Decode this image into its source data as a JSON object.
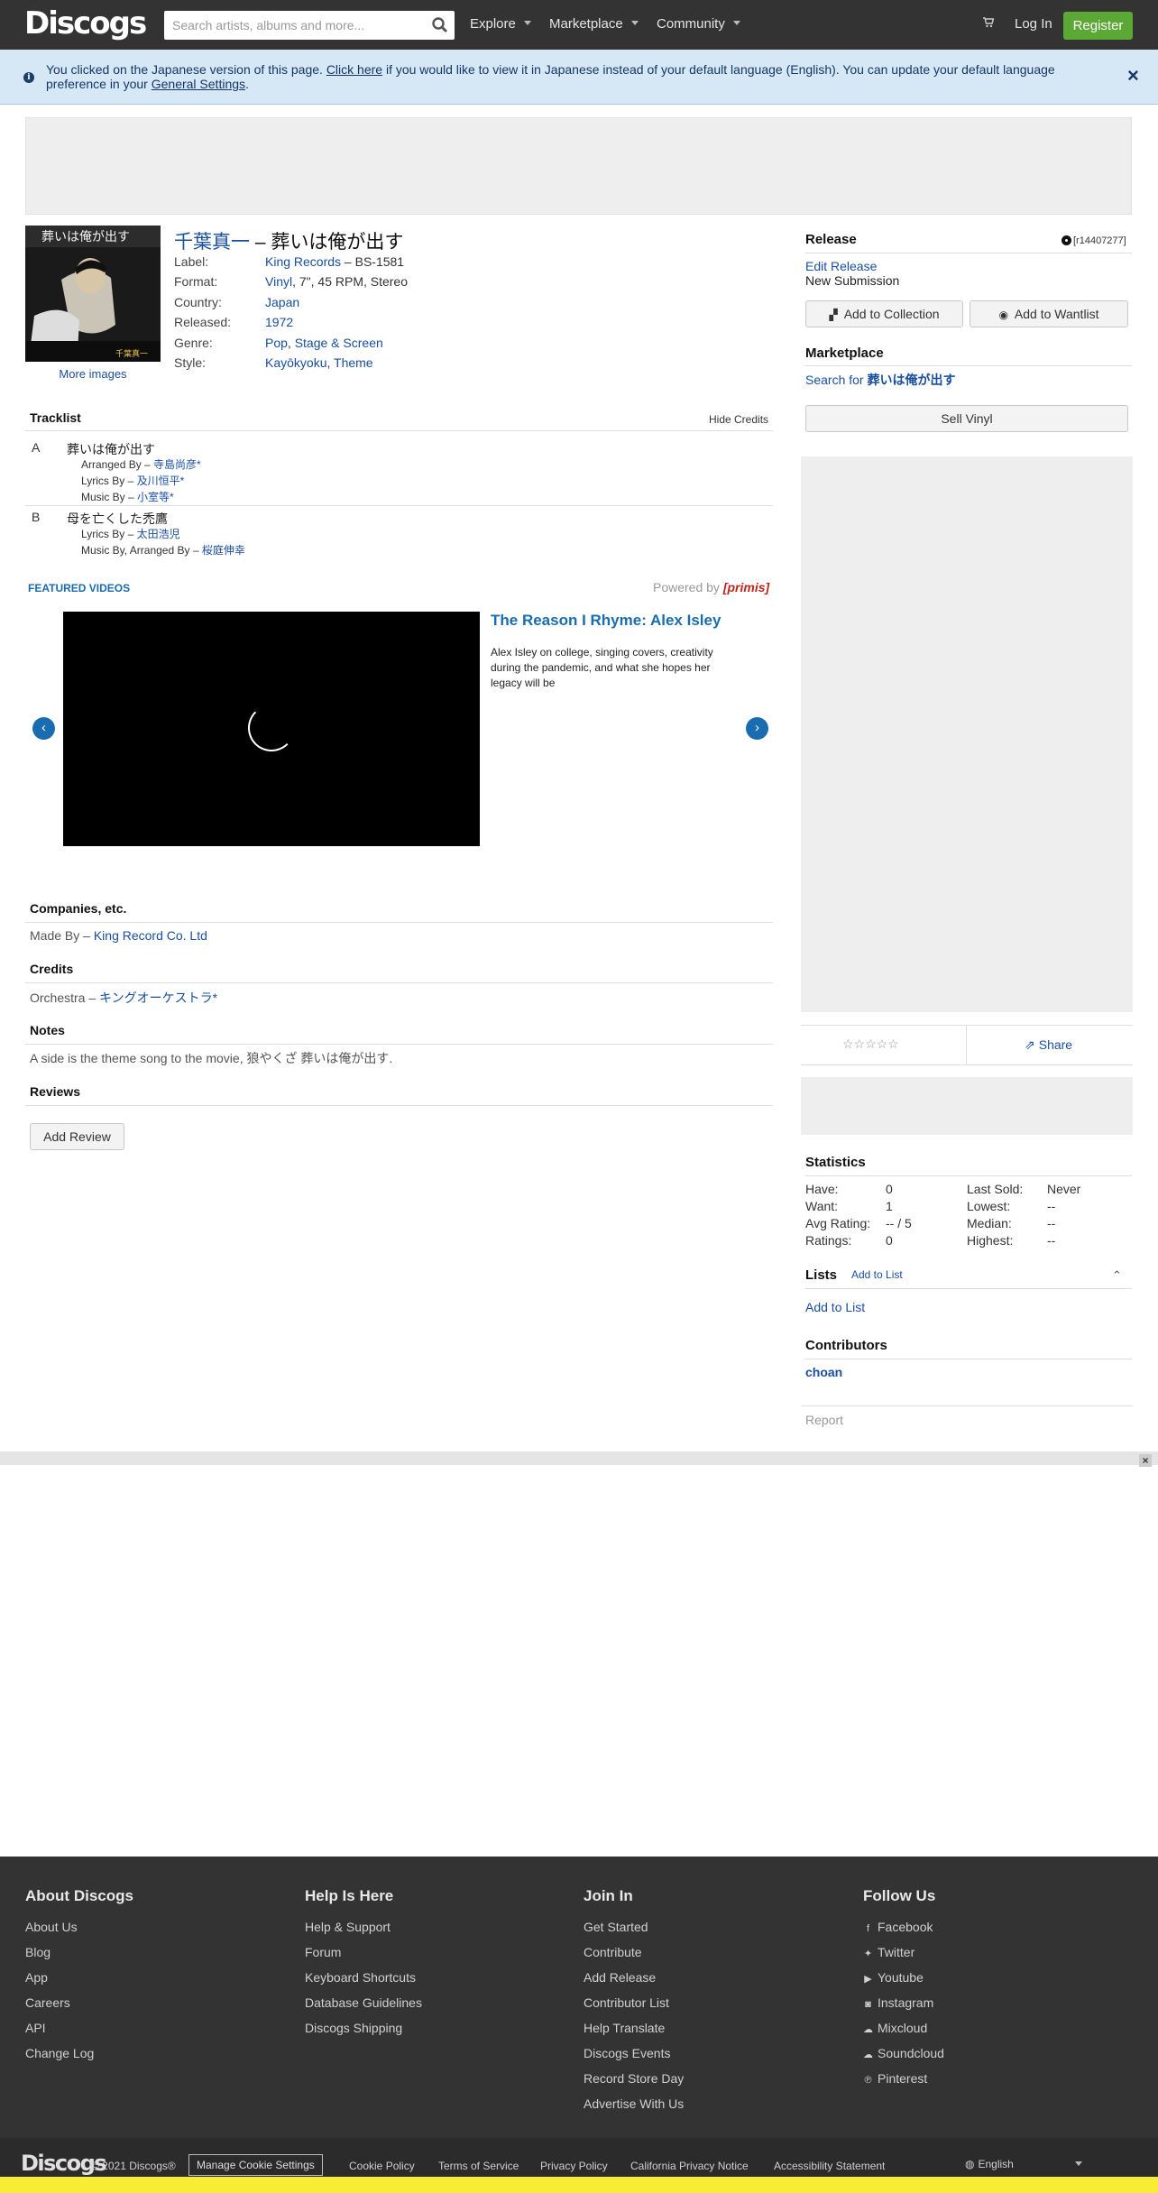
{
  "header": {
    "logo": "Discogs",
    "search_placeholder": "Search artists, albums and more...",
    "nav": [
      "Explore",
      "Marketplace",
      "Community"
    ],
    "login": "Log In",
    "register": "Register",
    "accent": "#5ca834"
  },
  "notice": {
    "text_1": "You clicked on the Japanese version of this page. ",
    "link_1": "Click here",
    "text_2": " if you would like to view it in Japanese instead of your default language (English). You can update your default language preference in your ",
    "link_2": "General Settings",
    "text_3": ".",
    "close": "×"
  },
  "release": {
    "artist": "千葉真一",
    "sep": " – ",
    "title": "葬いは俺が出す",
    "more_images": "More images",
    "cover_text": "葬いは俺が出す",
    "cover_artist": "千葉真一",
    "profile": [
      {
        "key": "Label:",
        "v1": "King Records",
        "v2": " – BS-1581"
      },
      {
        "key": "Format:",
        "v1": "Vinyl",
        "v2": ", 7\", 45 RPM, Stereo"
      },
      {
        "key": "Country:",
        "v1": "Japan",
        "v2": ""
      },
      {
        "key": "Released:",
        "v1": "1972",
        "v2": ""
      },
      {
        "key": "Genre:",
        "v1": "Pop",
        "v2": ", ",
        "v3": "Stage & Screen"
      },
      {
        "key": "Style:",
        "v1": "Kayōkyoku",
        "v2": ", ",
        "v3": "Theme"
      }
    ]
  },
  "tracklist": {
    "heading": "Tracklist",
    "hide_credits": "Hide Credits",
    "tracks": [
      {
        "pos": "A",
        "title": "葬いは俺が出す",
        "credits": [
          {
            "role": "Arranged By – ",
            "name": "寺島尚彦*"
          },
          {
            "role": "Lyrics By – ",
            "name": "及川恒平*"
          },
          {
            "role": "Music By – ",
            "name": "小室等*"
          }
        ]
      },
      {
        "pos": "B",
        "title": "母を亡くした禿鷹",
        "credits": [
          {
            "role": "Lyrics By – ",
            "name": "太田浩児"
          },
          {
            "role": "Music By, Arranged By – ",
            "name": "桜庭伸幸"
          }
        ]
      }
    ]
  },
  "video": {
    "label": "FEATURED VIDEOS",
    "powered": "Powered by ",
    "brand": "[primis]",
    "title": "The Reason I Rhyme: Alex Isley",
    "desc": "Alex Isley on college, singing covers, creativity during the pandemic, and what she hopes her legacy will be",
    "prev": "‹",
    "next": "›"
  },
  "companies": {
    "heading": "Companies, etc.",
    "role": "Made By – ",
    "name": "King Record Co. Ltd"
  },
  "credits": {
    "heading": "Credits",
    "role": "Orchestra – ",
    "name": "キングオーケストラ*"
  },
  "notes": {
    "heading": "Notes",
    "text": "A side is the theme song to the movie, 狼やくざ 葬いは俺が出す."
  },
  "reviews": {
    "heading": "Reviews",
    "add": "Add Review"
  },
  "sidebar": {
    "release_h": "Release",
    "release_id": "[r14407277]",
    "edit_release": "Edit Release",
    "status": "New Submission",
    "add_collection": "Add to Collection",
    "add_wantlist": "Add to Wantlist",
    "marketplace_h": "Marketplace",
    "search_for": "Search for ",
    "search_title": "葬いは俺が出す",
    "sell": "Sell Vinyl",
    "stars": "☆☆☆☆☆",
    "share": "Share",
    "statistics_h": "Statistics",
    "stats_left": [
      {
        "k": "Have:",
        "v": "0"
      },
      {
        "k": "Want:",
        "v": "1"
      },
      {
        "k": "Avg Rating:",
        "v": "-- / 5"
      },
      {
        "k": "Ratings:",
        "v": "0"
      }
    ],
    "stats_right": [
      {
        "k": "Last Sold:",
        "v": "Never"
      },
      {
        "k": "Lowest:",
        "v": "--"
      },
      {
        "k": "Median:",
        "v": "--"
      },
      {
        "k": "Highest:",
        "v": "--"
      }
    ],
    "lists_h": "Lists",
    "lists_add_small": "Add to List",
    "lists_add": "Add to List",
    "contributors_h": "Contributors",
    "contributor": "choan",
    "report": "Report"
  },
  "strip_close": "×",
  "footer": {
    "columns": [
      {
        "heading": "About Discogs",
        "links": [
          "About Us",
          "Blog",
          "App",
          "Careers",
          "API",
          "Change Log"
        ]
      },
      {
        "heading": "Help Is Here",
        "links": [
          "Help & Support",
          "Forum",
          "Keyboard Shortcuts",
          "Database Guidelines",
          "Discogs Shipping"
        ]
      },
      {
        "heading": "Join In",
        "links": [
          "Get Started",
          "Contribute",
          "Add Release",
          "Contributor List",
          "Help Translate",
          "Discogs Events",
          "Record Store Day",
          "Advertise With Us"
        ]
      },
      {
        "heading": "Follow Us",
        "links": [
          "Facebook",
          "Twitter",
          "Youtube",
          "Instagram",
          "Mixcloud",
          "Soundcloud",
          "Pinterest"
        ]
      }
    ],
    "logo": "Discogs",
    "copyright": "© 2021 Discogs®",
    "cookie_settings": "Manage Cookie Settings",
    "bottom_links": [
      "Cookie Policy",
      "Terms of Service",
      "Privacy Policy",
      "California Privacy Notice",
      "Accessibility Statement"
    ],
    "language": "English"
  }
}
